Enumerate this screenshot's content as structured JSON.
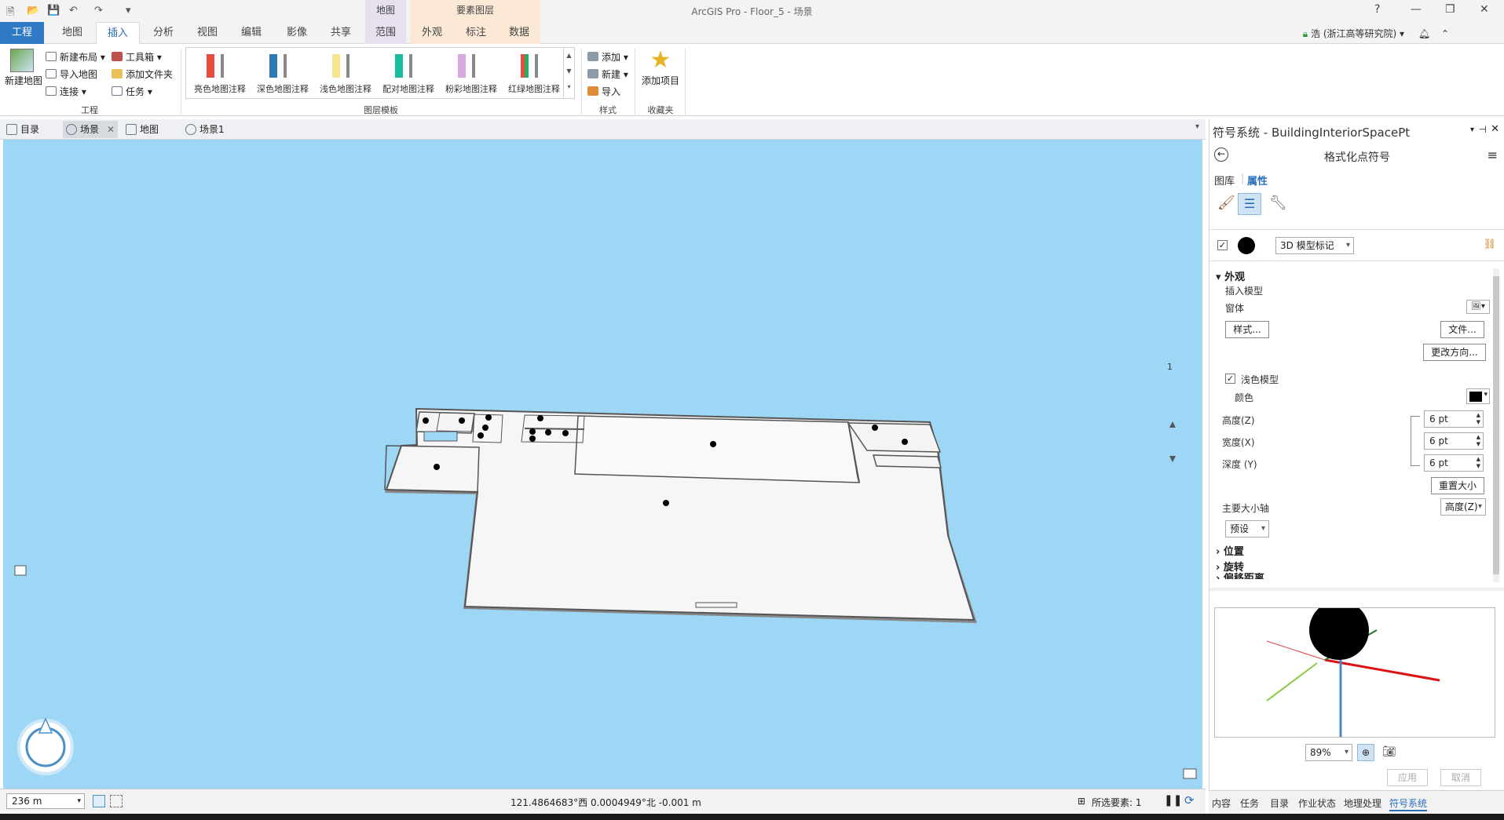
{
  "window": {
    "title": "ArcGIS Pro - Floor_5 - 场景",
    "context_tab_map": "地图",
    "context_tab_feature": "要素图层",
    "help": "?",
    "minimize": "—",
    "restore": "❐",
    "close": "✕"
  },
  "tabs": [
    "工程",
    "地图",
    "插入",
    "分析",
    "视图",
    "编辑",
    "影像",
    "共享",
    "范围",
    "外观",
    "标注",
    "数据"
  ],
  "user": "浩 (浙江高等研究院)",
  "ribbon": {
    "project_group": {
      "new_map": "新建地图",
      "new_layout": "新建布局",
      "import_map": "导入地图",
      "connect": "连接",
      "toolbox": "工具箱",
      "add_folder": "添加文件夹",
      "task": "任务",
      "label": "工程"
    },
    "layer_templates": {
      "items": [
        "亮色地图注释",
        "深色地图注释",
        "浅色地图注释",
        "配对地图注释",
        "粉彩地图注释",
        "红绿地图注释"
      ],
      "label": "图层模板"
    },
    "styles_group": {
      "add": "添加",
      "new": "新建",
      "import": "导入",
      "label": "样式"
    },
    "favorites_group": {
      "add_item": "添加项目",
      "label": "收藏夹"
    }
  },
  "doc_tabs": [
    "目录",
    "场景",
    "地图",
    "场景1"
  ],
  "scene": {
    "nav_page": "1"
  },
  "status": {
    "scale": "236 m",
    "coords": "121.4864683°西 0.0004949°北  -0.001 m",
    "selected": "所选要素: 1"
  },
  "pane": {
    "title": "符号系统 - BuildingInteriorSpacePt",
    "subtitle": "格式化点符号",
    "gallery_tab": "图库",
    "properties_tab": "属性",
    "symbol_type": "3D 模型标记",
    "appearance": "外观",
    "insert_model": "插入模型",
    "body": "窗体",
    "style_btn": "样式...",
    "file_btn": "文件...",
    "change_orientation_btn": "更改方向...",
    "light_model": "浅色模型",
    "color": "颜色",
    "height_label": "高度(Z)",
    "width_label": "宽度(X)",
    "depth_label": "深度 (Y)",
    "height_val": "6 pt",
    "width_val": "6 pt",
    "depth_val": "6 pt",
    "reset_size_btn": "重置大小",
    "primary_axis": "主要大小轴",
    "primary_axis_val": "高度(Z)",
    "preset": "预设",
    "position": "位置",
    "rotation": "旋转",
    "clip": "偏移距离",
    "zoom": "89%",
    "apply_btn": "应用",
    "cancel_btn": "取消"
  },
  "pane_tabs": [
    "内容",
    "任务",
    "目录",
    "作业状态",
    "地理处理",
    "符号系统"
  ],
  "colors": {
    "accent": "#2a6ebb",
    "scene_bg": "#9dd7f5",
    "project_tab": "#2f79c5"
  }
}
